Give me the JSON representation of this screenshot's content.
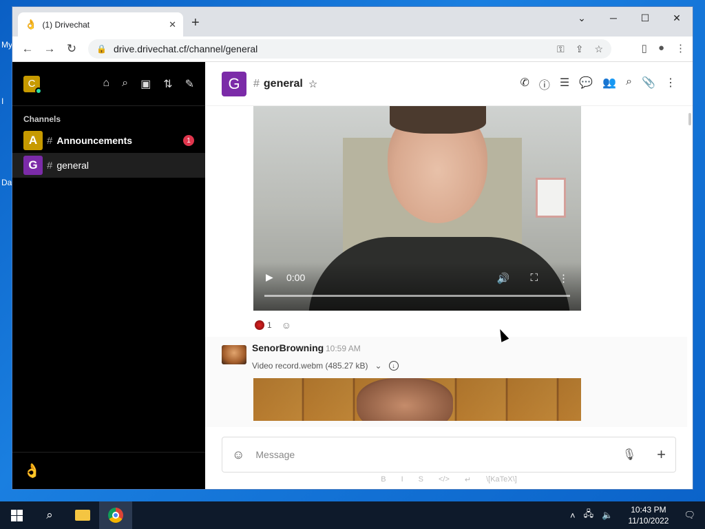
{
  "desktop": {
    "labels": [
      "My",
      "I",
      "Da"
    ]
  },
  "browser": {
    "tab_title": "(1) Drivechat",
    "tab_favicon": "hand-icon",
    "new_tab": "+",
    "url": "drive.drivechat.cf/channel/general",
    "window_controls": {
      "minimize": "─",
      "maximize": "☐",
      "close": "✕",
      "tabs_dropdown": "⌄"
    }
  },
  "sidebar": {
    "workspace_initial": "C",
    "section_title": "Channels",
    "channels": [
      {
        "initial": "A",
        "name": "Announcements",
        "color": "#c79a00",
        "unread": "1",
        "active": false
      },
      {
        "initial": "G",
        "name": "general",
        "color": "#7b2ba8",
        "unread": "",
        "active": true
      }
    ]
  },
  "room": {
    "initial": "G",
    "name": "general",
    "color": "#7b2ba8"
  },
  "messages": {
    "video1": {
      "time": "0:00"
    },
    "reactions": [
      {
        "emoji": "red-ball",
        "count": "1"
      }
    ],
    "second": {
      "author": "SenorBrowning",
      "time": "10:59 AM",
      "file": "Video record.webm (485.27 kB)"
    }
  },
  "composer": {
    "placeholder": "Message",
    "format_bar": [
      "B",
      "I",
      "S",
      "</>",
      "↵",
      "\\[KaTeX\\]"
    ]
  },
  "taskbar": {
    "time": "10:43 PM",
    "date": "11/10/2022"
  },
  "colors": {
    "accent_red": "#e0364d",
    "sidebar_bg": "#000000",
    "room_purple": "#7b2ba8",
    "announcements_gold": "#c79a00"
  }
}
